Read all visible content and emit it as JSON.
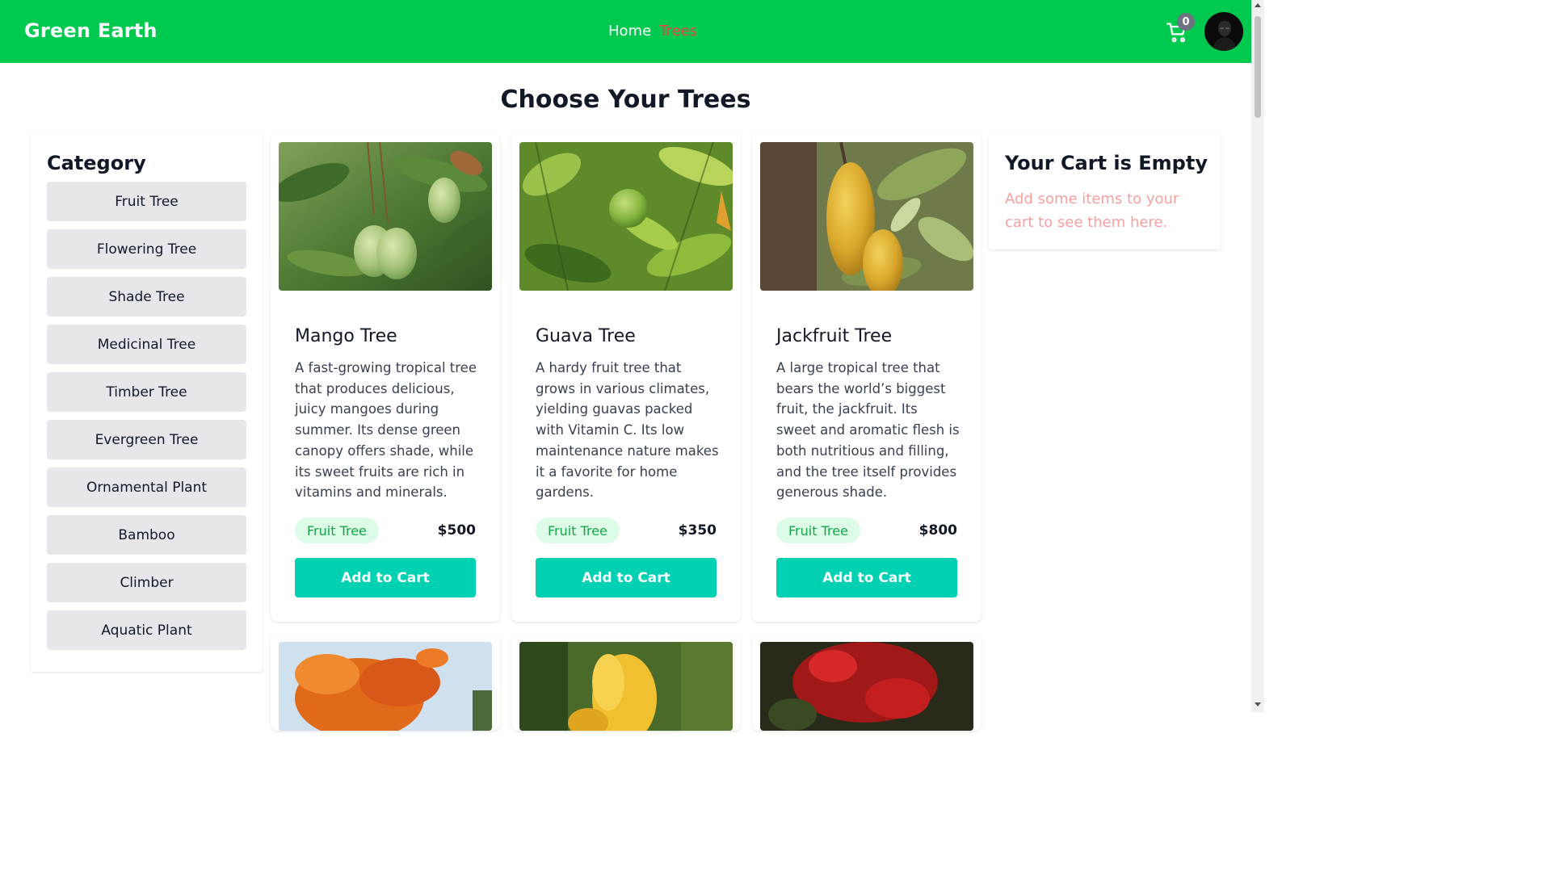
{
  "navbar": {
    "brand": "Green Earth",
    "links": [
      "Home",
      "Trees"
    ],
    "active_link": "Trees",
    "cart_count": "0",
    "icons": {
      "cart": "cart-icon",
      "avatar": "avatar"
    }
  },
  "colors": {
    "navbar_bg": "#00c950",
    "active_link": "#ef4444",
    "add_button": "#00d1b2",
    "tag_bg": "#dcfce7",
    "tag_text": "#16a34a",
    "cart_msg": "#f8a0a0"
  },
  "page": {
    "title": "Choose Your Trees"
  },
  "category": {
    "title": "Category",
    "items": [
      "Fruit Tree",
      "Flowering Tree",
      "Shade Tree",
      "Medicinal Tree",
      "Timber Tree",
      "Evergreen Tree",
      "Ornamental Plant",
      "Bamboo",
      "Climber",
      "Aquatic Plant"
    ]
  },
  "products": [
    {
      "name": "Mango Tree",
      "description": "A fast-growing tropical tree that produces delicious, juicy mangoes during summer. Its dense green canopy offers shade, while its sweet fruits are rich in vitamins and minerals.",
      "category": "Fruit Tree",
      "price": "$500",
      "button": "Add to Cart"
    },
    {
      "name": "Guava Tree",
      "description": "A hardy fruit tree that grows in various climates, yielding guavas packed with Vitamin C. Its low maintenance nature makes it a favorite for home gardens.",
      "category": "Fruit Tree",
      "price": "$350",
      "button": "Add to Cart"
    },
    {
      "name": "Jackfruit Tree",
      "description": "A large tropical tree that bears the world’s biggest fruit, the jackfruit. Its sweet and aromatic flesh is both nutritious and filling, and the tree itself provides generous shade.",
      "category": "Fruit Tree",
      "price": "$800",
      "button": "Add to Cart"
    }
  ],
  "cart": {
    "title": "Your Cart is Empty",
    "message": "Add some items to your cart to see them here."
  }
}
